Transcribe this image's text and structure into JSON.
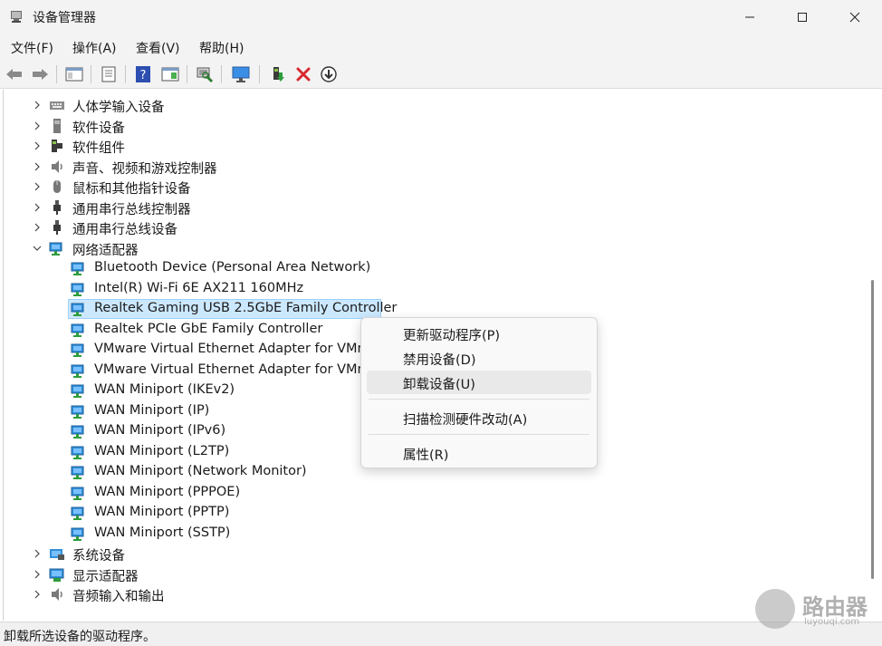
{
  "window": {
    "title": "设备管理器"
  },
  "menu": [
    {
      "id": "file",
      "label": "文件(F)"
    },
    {
      "id": "action",
      "label": "操作(A)"
    },
    {
      "id": "view",
      "label": "查看(V)"
    },
    {
      "id": "help",
      "label": "帮助(H)"
    }
  ],
  "tree": {
    "categories_top": [
      {
        "label": "人体学输入设备",
        "icon": "keyboard-icon"
      },
      {
        "label": "软件设备",
        "icon": "software-device-icon"
      },
      {
        "label": "软件组件",
        "icon": "software-component-icon"
      },
      {
        "label": "声音、视频和游戏控制器",
        "icon": "speaker-icon"
      },
      {
        "label": "鼠标和其他指针设备",
        "icon": "mouse-icon"
      },
      {
        "label": "通用串行总线控制器",
        "icon": "usb-icon"
      },
      {
        "label": "通用串行总线设备",
        "icon": "usb-icon"
      }
    ],
    "network": {
      "label": "网络适配器",
      "children": [
        "Bluetooth Device (Personal Area Network)",
        "Intel(R) Wi-Fi 6E AX211 160MHz",
        "Realtek Gaming USB 2.5GbE Family Controller",
        "Realtek PCIe GbE Family Controller",
        "VMware Virtual Ethernet Adapter for VMnet",
        "VMware Virtual Ethernet Adapter for VMnet",
        "WAN Miniport (IKEv2)",
        "WAN Miniport (IP)",
        "WAN Miniport (IPv6)",
        "WAN Miniport (L2TP)",
        "WAN Miniport (Network Monitor)",
        "WAN Miniport (PPPOE)",
        "WAN Miniport (PPTP)",
        "WAN Miniport (SSTP)"
      ],
      "selected_child": "Realtek Gaming USB 2.5GbE Family Controller"
    },
    "categories_bottom": [
      {
        "label": "系统设备",
        "icon": "system-device-icon"
      },
      {
        "label": "显示适配器",
        "icon": "display-adapter-icon"
      },
      {
        "label": "音频输入和输出",
        "icon": "speaker-icon"
      }
    ]
  },
  "context_menu": {
    "items": [
      {
        "id": "update-driver",
        "label": "更新驱动程序(P)"
      },
      {
        "id": "disable-device",
        "label": "禁用设备(D)"
      },
      {
        "id": "uninstall-device",
        "label": "卸载设备(U)",
        "highlighted": true
      },
      {
        "id": "scan-hardware",
        "label": "扫描检测硬件改动(A)"
      },
      {
        "id": "properties",
        "label": "属性(R)"
      }
    ]
  },
  "status": {
    "text": "卸载所选设备的驱动程序。"
  },
  "watermark": {
    "title": "路由器",
    "subtitle": "luyouqi.com"
  },
  "colors": {
    "selection": "#cce8ff",
    "selection_border": "#99d1ff",
    "delete_red": "#d9282f",
    "network_blue": "#2f8fd8"
  }
}
